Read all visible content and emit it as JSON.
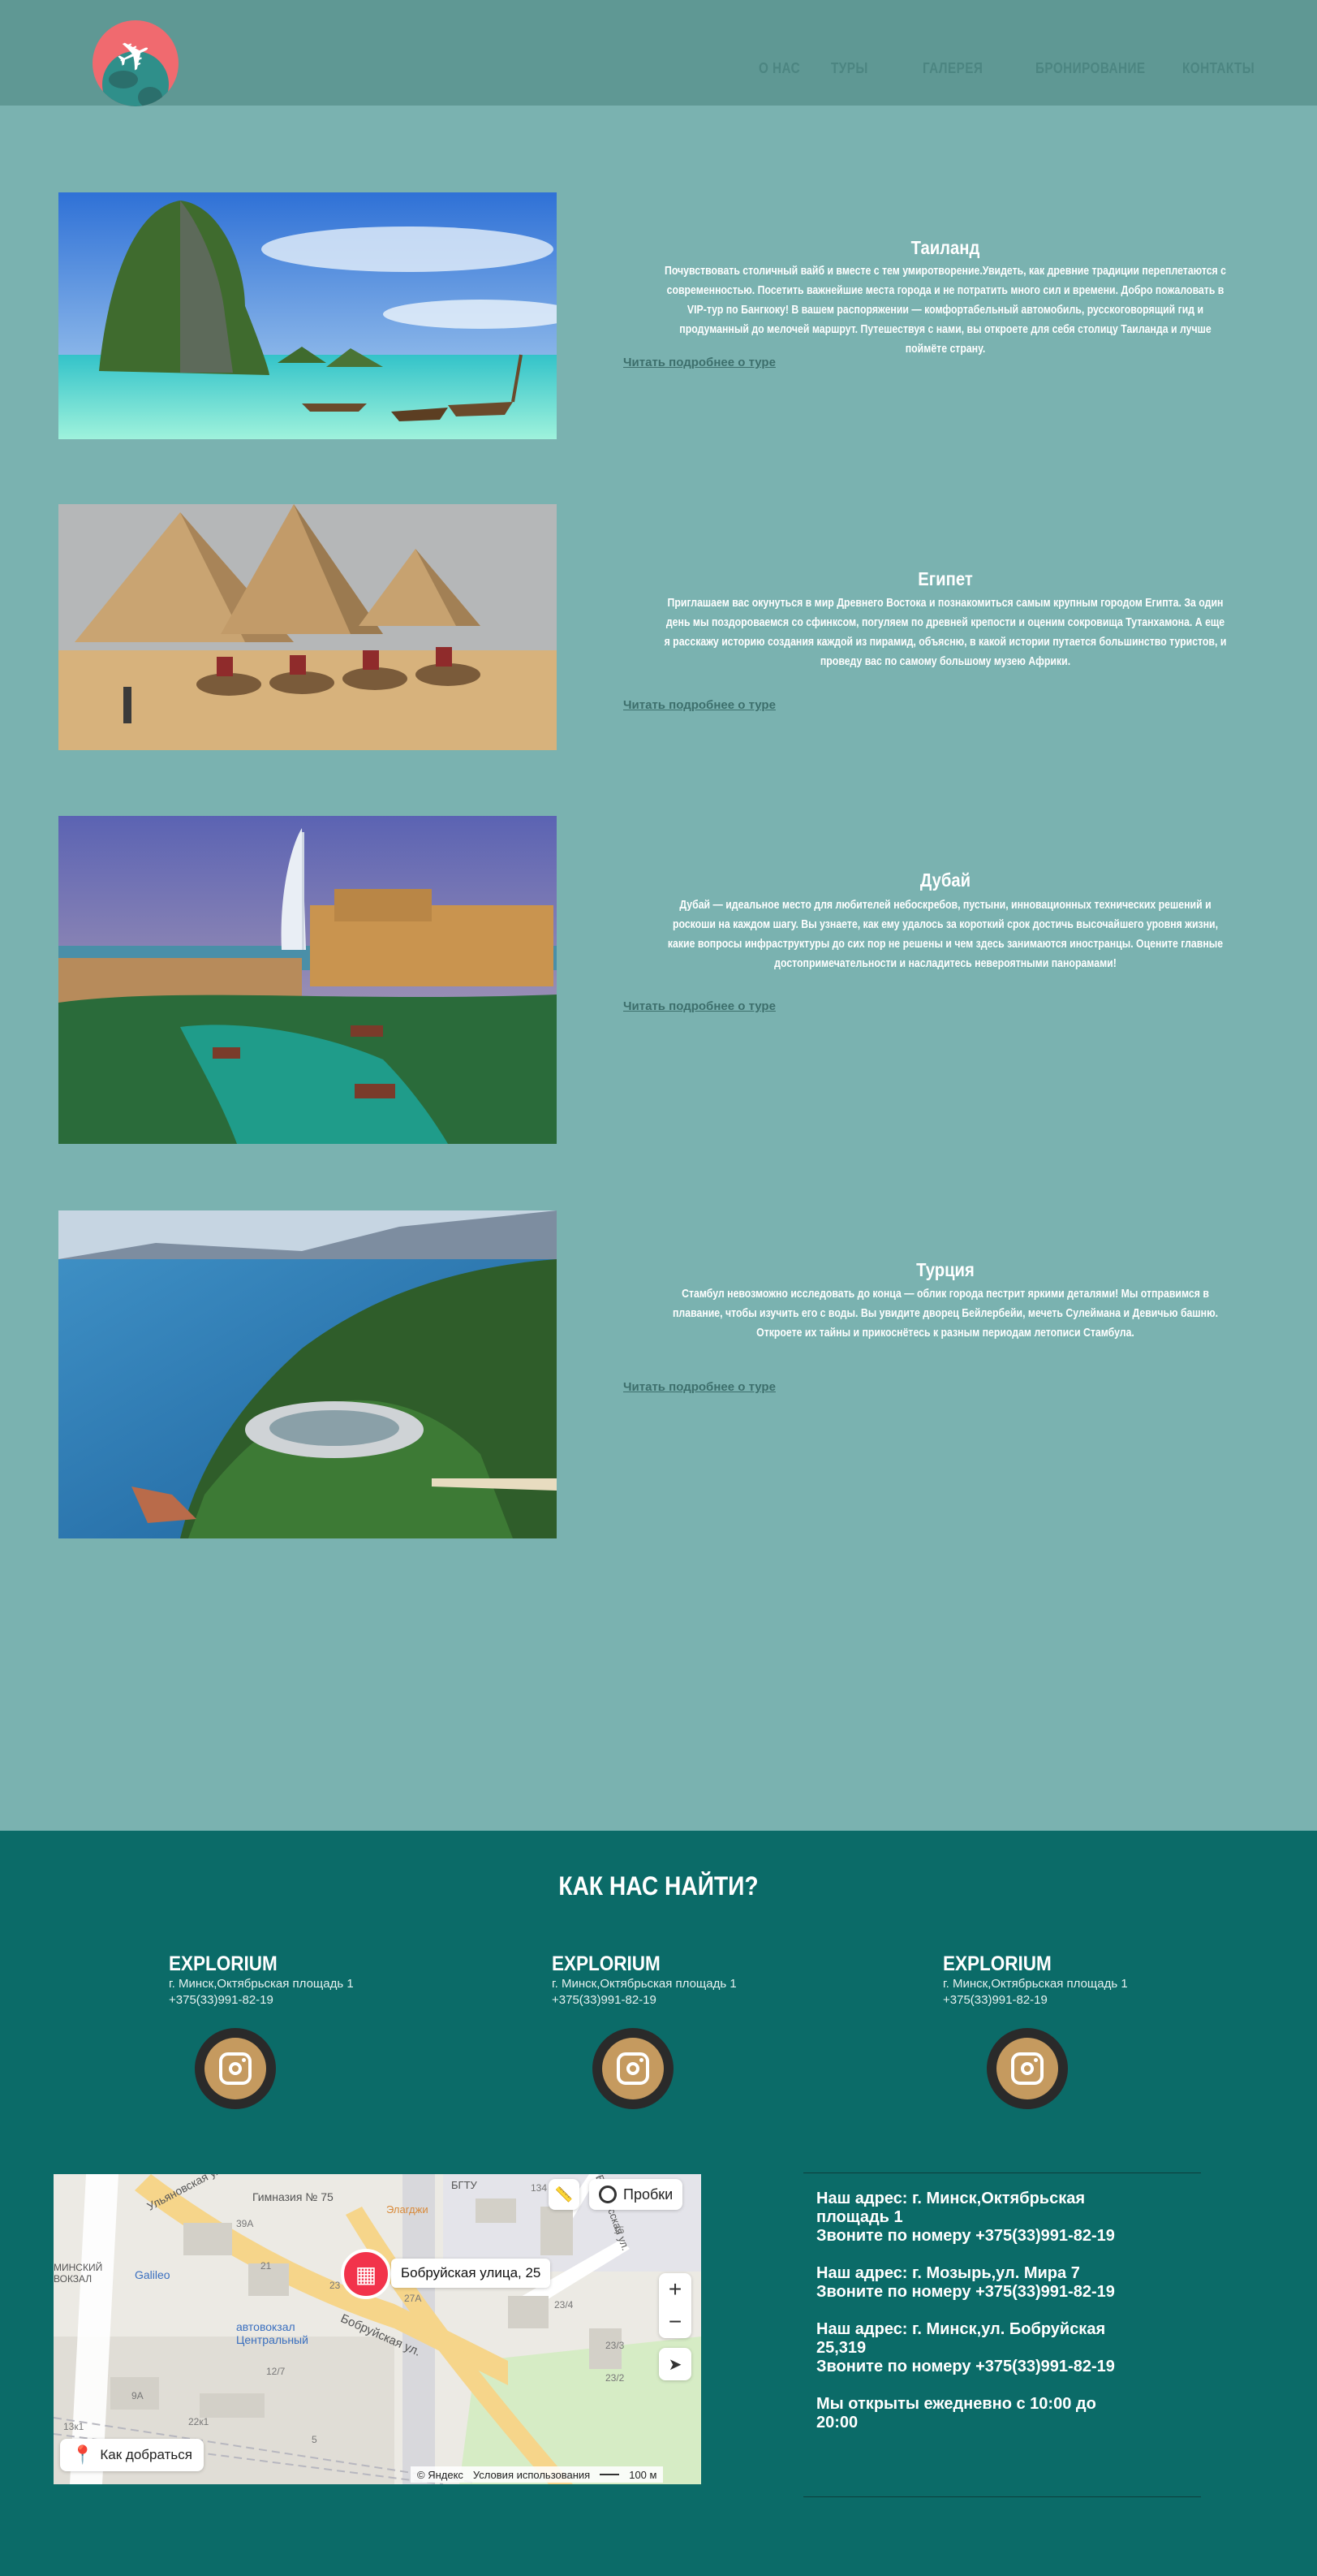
{
  "header": {
    "nav": [
      {
        "key": "about",
        "label": "О НАС"
      },
      {
        "key": "tours",
        "label": "ТУРЫ"
      },
      {
        "key": "gallery",
        "label": "ГАЛЕРЕЯ"
      },
      {
        "key": "booking",
        "label": "БРОНИРОВАНИЕ"
      },
      {
        "key": "contacts",
        "label": "КОНТАКТЫ"
      }
    ]
  },
  "tours": [
    {
      "title": "Таиланд",
      "description": "Почувствовать столичный вайб и вместе с тем умиротворение.Увидеть, как древние традиции переплетаются с современностью. Посетить важнейшие места города и не потратить много сил и времени. Добро пожаловать в VIP-тур по Бангкоку! В вашем распоряжении — комфортабельный автомобиль, русскоговорящий гид и продуманный до мелочей маршрут. Путешествуя с нами, вы откроете для себя столицу Таиланда и лучше поймёте страну.",
      "link": "Читать подробнее о туре"
    },
    {
      "title": "Египет",
      "description": "Приглашаем вас окунуться в мир Древнего Востока и познакомиться самым крупным городом Египта. За один день мы поздороваемся со сфинксом, погуляем по древней крепости и оценим сокровища Тутанхамона. А еще я расскажу историю создания каждой из пирамид, объясню, в какой истории путается большинство туристов, и проведу вас по самому большому музею Африки.",
      "link": "Читать подробнее о туре"
    },
    {
      "title": "Дубай",
      "description": "Дубай — идеальное место для любителей небоскребов, пустыни, инновационных технических решений и роскоши на каждом шагу. Вы узнаете, как ему удалось за короткий срок достичь высочайшего уровня жизни, какие вопросы инфраструктуры до сих пор не решены и чем здесь занимаются иностранцы. Оцените главные достопримечательности и насладитесь невероятными панорамами!",
      "link": "Читать подробнее о туре"
    },
    {
      "title": "Турция",
      "description": "Стамбул невозможно исследовать до конца — облик города пестрит яркими деталями! Мы отправимся в плавание, чтобы изучить его с воды. Вы увидите дворец Бейлербейи, мечеть Сулеймана и Девичью башню. Откроете их тайны и прикоснётесь к разным периодам летописи Стамбула.",
      "link": "Читать подробнее о туре"
    }
  ],
  "footer": {
    "title": "КАК НАС НАЙТИ?",
    "offices": [
      {
        "brand": "EXPLORIUM",
        "address": "г. Минск,Октябрьская площадь 1",
        "phone": "+375(33)991-82-19"
      },
      {
        "brand": "EXPLORIUM",
        "address": "г. Минск,Октябрьская площадь 1",
        "phone": "+375(33)991-82-19"
      },
      {
        "brand": "EXPLORIUM",
        "address": "г. Минск,Октябрьская площадь 1",
        "phone": "+375(33)991-82-19"
      }
    ],
    "map": {
      "place_label": "Бобруйская улица, 25",
      "traffic_button": "Пробки",
      "route_button": "Как добраться",
      "copyright": "© Яндекс",
      "terms": "Условия использования",
      "scale": "100 м",
      "labels": {
        "school": "Гимназия № 75",
        "elardzhi": "Элarджи",
        "galileo": "Galileo",
        "station": "автовокзал Центральный",
        "minsk_station": "МИНСКИЙ ВОКЗАЛ",
        "bgtu": "БГТУ",
        "street_bobr": "Бобруйская ул.",
        "street_belorus": "Белорусская ул.",
        "street_ulyan": "Ульяновская ул.",
        "house_39a": "39А",
        "house_21": "21",
        "house_23": "23",
        "house_27a": "27А",
        "house_23_4": "23/4",
        "house_23_3": "23/3",
        "house_23_2": "23/2",
        "house_15": "15",
        "house_5": "5",
        "house_12_7": "12/7",
        "house_22_1": "22к1",
        "house_13_1": "13к1",
        "house_9a": "9А",
        "house_134": "134"
      }
    },
    "info": [
      {
        "line1": "Наш адрес: г. Минск,Октябрьская площадь 1",
        "line2": "Звоните по номеру +375(33)991-82-19"
      },
      {
        "line1": "Наш адрес: г. Мозырь,ул. Мира 7",
        "line2": "Звоните по номеру +375(33)991-82-19"
      },
      {
        "line1": "Наш адрес: г. Минск,ул. Бобруйская 25,319",
        "line2": "Звоните по номеру +375(33)991-82-19"
      },
      {
        "line1": "Мы открыты ежедневно с 10:00 до 20:00",
        "line2": ""
      }
    ]
  }
}
